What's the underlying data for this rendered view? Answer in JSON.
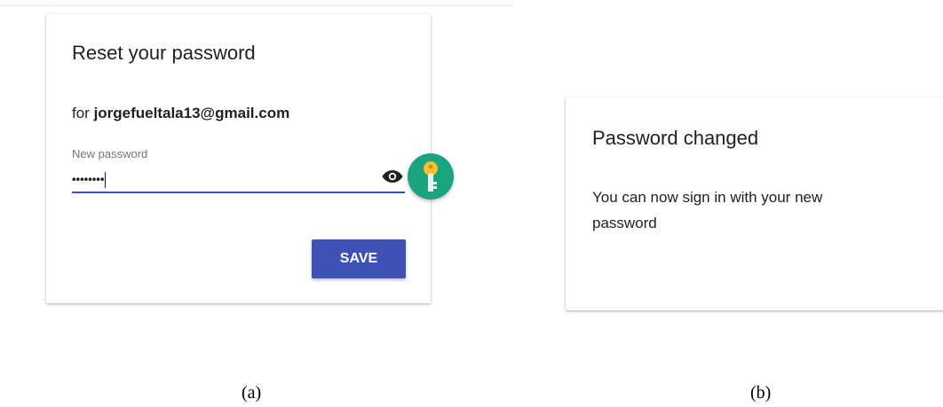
{
  "reset_card": {
    "title": "Reset your password",
    "email_prefix": "for ",
    "email": "jorgefueltala13@gmail.com",
    "field_label": "New password",
    "password_masked": "••••••••",
    "save_label": "SAVE"
  },
  "changed_card": {
    "title": "Password changed",
    "message": "You can now sign in with your new password"
  },
  "captions": {
    "a": "(a)",
    "b": "(b)"
  },
  "icons": {
    "visibility": "eye-icon",
    "password_manager": "key-icon"
  },
  "colors": {
    "primary": "#3f51b5",
    "fab": "#1aa37f",
    "key": "#f9c22e"
  }
}
